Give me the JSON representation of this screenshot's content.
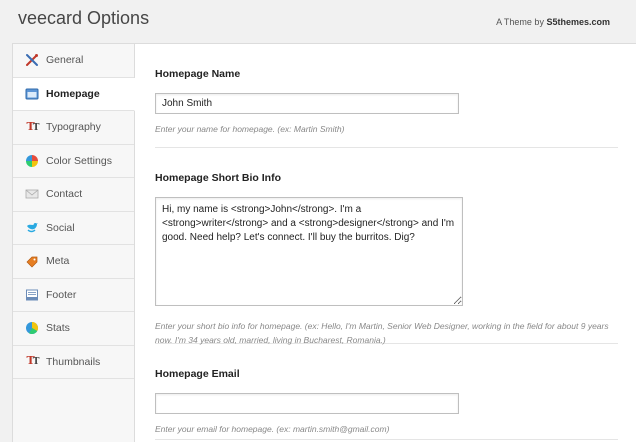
{
  "header": {
    "title": "veecard Options",
    "credit_prefix": "A Theme by",
    "credit_brand": "S5themes.com"
  },
  "sidebar": {
    "items": [
      {
        "label": "General",
        "icon": "tools-icon"
      },
      {
        "label": "Homepage",
        "icon": "browser-window-icon",
        "active": true
      },
      {
        "label": "Typography",
        "icon": "typography-icon"
      },
      {
        "label": "Color Settings",
        "icon": "color-wheel-icon"
      },
      {
        "label": "Contact",
        "icon": "envelope-icon"
      },
      {
        "label": "Social",
        "icon": "twitter-bird-icon"
      },
      {
        "label": "Meta",
        "icon": "tag-icon"
      },
      {
        "label": "Footer",
        "icon": "footer-layout-icon"
      },
      {
        "label": "Stats",
        "icon": "pie-chart-icon"
      },
      {
        "label": "Thumbnails",
        "icon": "typography-icon"
      }
    ]
  },
  "fields": {
    "name": {
      "label": "Homepage Name",
      "value": "John Smith",
      "help": "Enter your name for homepage. (ex: Martin Smith)"
    },
    "bio": {
      "label": "Homepage Short Bio Info",
      "value": "Hi, my name is <strong>John</strong>. I'm a <strong>writer</strong> and a <strong>designer</strong> and I'm good. Need help? Let's connect. I'll buy the burritos. Dig?",
      "help": "Enter your short bio info for homepage. (ex: Hello, I'm Martin, Senior Web Designer, working in the field for about 9 years now. I'm 34 years old, married, living in Bucharest, Romania.)"
    },
    "email": {
      "label": "Homepage Email",
      "value": "",
      "help": "Enter your email for homepage. (ex: martin.smith@gmail.com)"
    }
  },
  "colors": {
    "active_bg": "#ffffff",
    "sidebar_bg": "#f7f7f7",
    "page_bg": "#f1f1f1",
    "border": "#dcdcdc"
  }
}
